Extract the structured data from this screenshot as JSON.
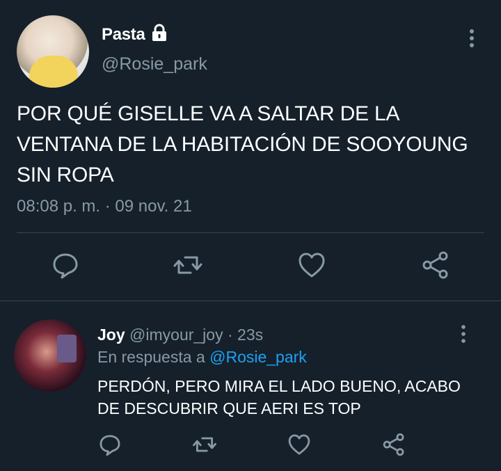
{
  "main_tweet": {
    "author_name": "Pasta",
    "handle": "@Rosie_park",
    "text": "POR QUÉ GISELLE VA A SALTAR DE LA VENTANA DE LA HABITACIÓN DE SOOYOUNG SIN ROPA",
    "time": "08:08 p. m.",
    "separator": " · ",
    "date": "09 nov. 21",
    "icons": [
      "lock-icon",
      "more-vertical-icon",
      "reply-icon",
      "retweet-icon",
      "like-icon",
      "share-icon"
    ]
  },
  "reply": {
    "author_name": "Joy",
    "handle": "@imyour_joy",
    "separator": " · ",
    "time": "23s",
    "in_reply_prefix": "En respuesta a ",
    "in_reply_handle": "@Rosie_park",
    "text": "PERDÓN, PERO MIRA EL LADO BUENO, ACABO DE DESCUBRIR QUE AERI ES TOP",
    "icons": [
      "more-vertical-icon",
      "reply-icon",
      "retweet-icon",
      "like-icon",
      "share-icon"
    ]
  },
  "colors": {
    "background": "#15202b",
    "text_primary": "#ffffff",
    "text_secondary": "#8899a6",
    "link": "#1da1f2",
    "divider": "#38444d"
  }
}
